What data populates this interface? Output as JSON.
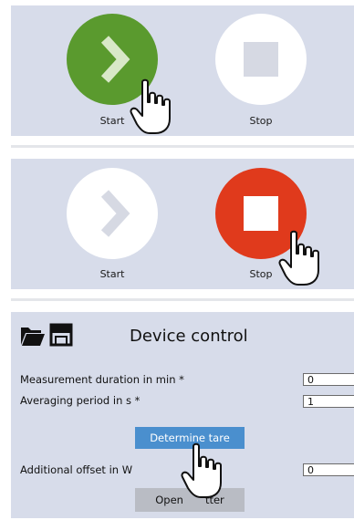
{
  "panel1": {
    "start_label": "Start",
    "stop_label": "Stop",
    "start_color": "#5a9a2e",
    "stop_color": "#ffffff"
  },
  "panel2": {
    "start_label": "Start",
    "stop_label": "Stop",
    "start_color": "#ffffff",
    "stop_color": "#e03a1c"
  },
  "device_control": {
    "title": "Device control",
    "toolbar_icons": [
      "folder-open-icon",
      "save-icon"
    ],
    "fields": [
      {
        "label": "Measurement duration in min *",
        "value": "0"
      },
      {
        "label": "Averaging period in s *",
        "value": "1"
      },
      {
        "label": "Additional offset in W",
        "value": "0"
      }
    ],
    "determine_tare_label": "Determine tare",
    "open_button_left": "Open",
    "open_button_right": "tter"
  }
}
